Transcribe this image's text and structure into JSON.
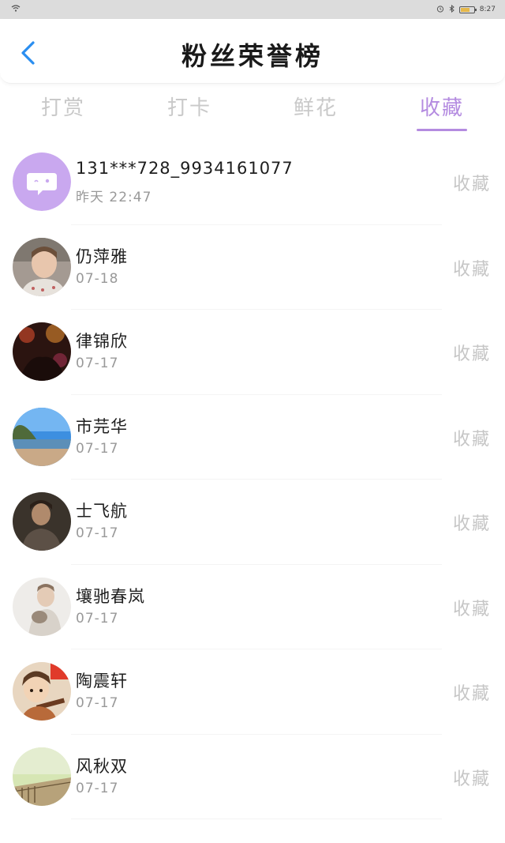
{
  "status_bar": {
    "time": "8:27"
  },
  "header": {
    "title": "粉丝荣誉榜"
  },
  "tabs": [
    {
      "label": "打赏",
      "active": false
    },
    {
      "label": "打卡",
      "active": false
    },
    {
      "label": "鲜花",
      "active": false
    },
    {
      "label": "收藏",
      "active": true
    }
  ],
  "colors": {
    "accent": "#b48be0",
    "muted": "#c6c6c6"
  },
  "fans": [
    {
      "name": "131***728_9934161077",
      "date": "昨天 22:47",
      "action": "收藏",
      "avatar": "default-chat-avatar"
    },
    {
      "name": "仍萍雅",
      "date": "07-18",
      "action": "收藏",
      "avatar": "child-photo-avatar"
    },
    {
      "name": "律锦欣",
      "date": "07-17",
      "action": "收藏",
      "avatar": "party-night-avatar"
    },
    {
      "name": "市芫华",
      "date": "07-17",
      "action": "收藏",
      "avatar": "seaside-avatar"
    },
    {
      "name": "士飞航",
      "date": "07-17",
      "action": "收藏",
      "avatar": "man-portrait-avatar"
    },
    {
      "name": "壤驰春岚",
      "date": "07-17",
      "action": "收藏",
      "avatar": "boy-cat-avatar"
    },
    {
      "name": "陶震轩",
      "date": "07-17",
      "action": "收藏",
      "avatar": "cartoon-avatar"
    },
    {
      "name": "风秋双",
      "date": "07-17",
      "action": "收藏",
      "avatar": "landscape-avatar"
    }
  ]
}
